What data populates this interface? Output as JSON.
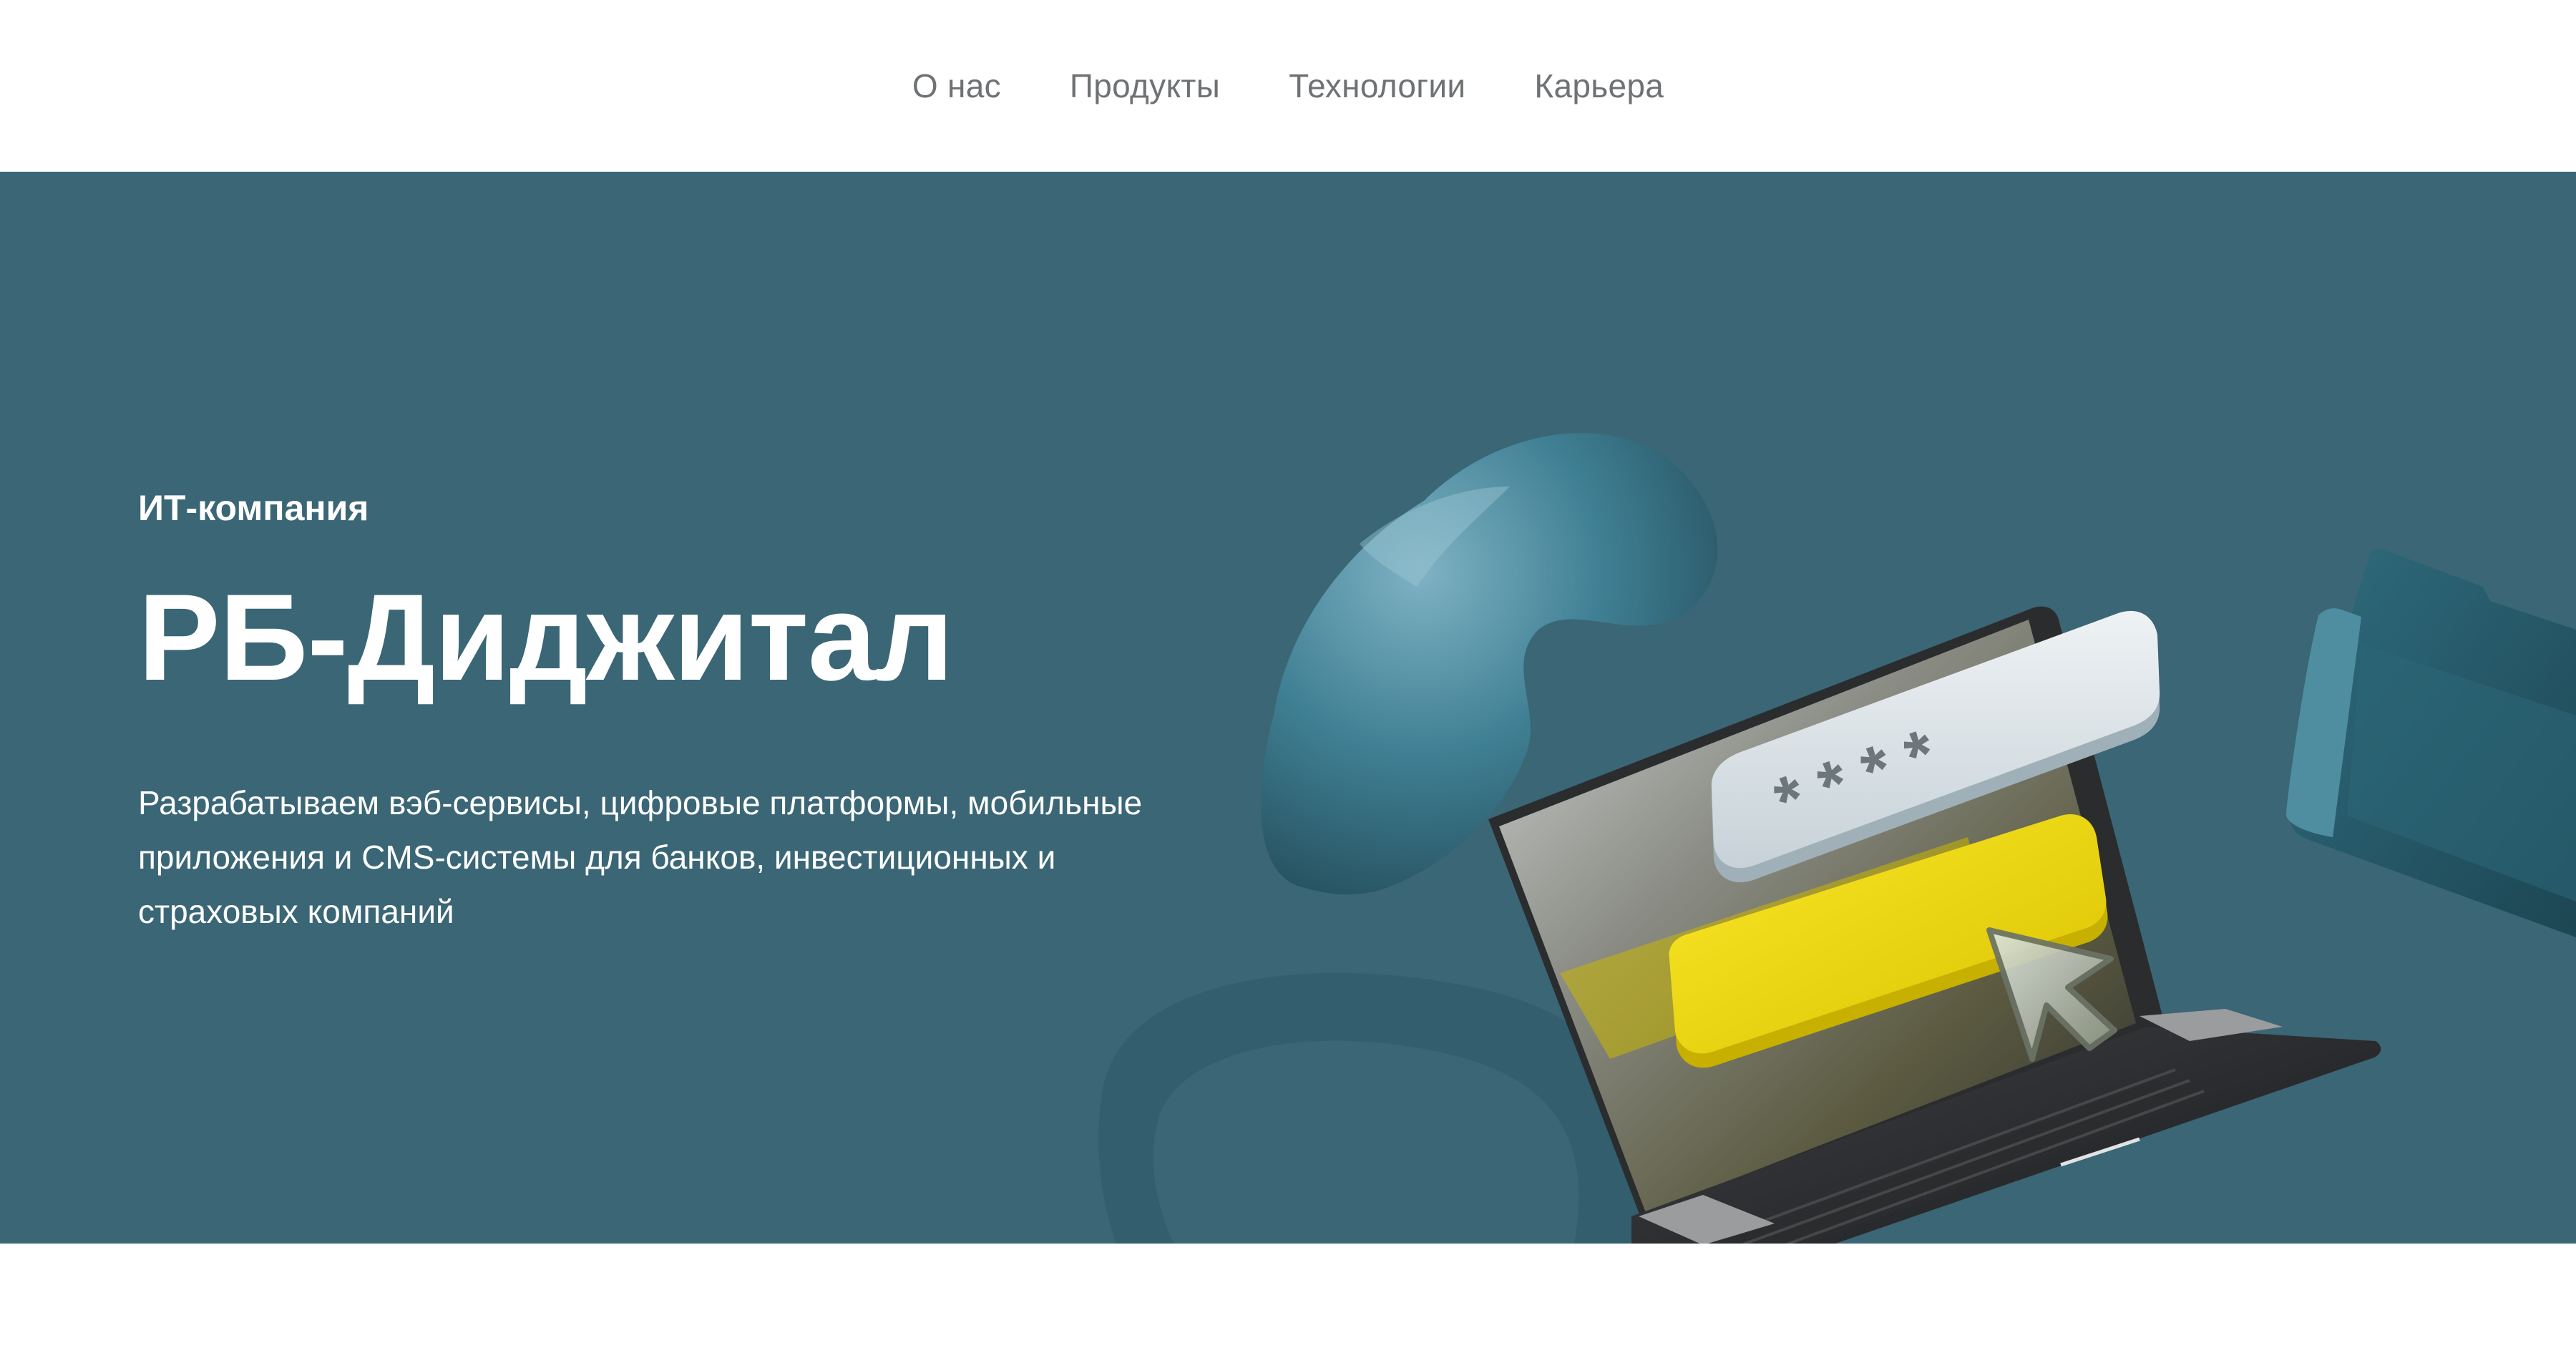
{
  "nav": {
    "items": [
      {
        "label": "О нас"
      },
      {
        "label": "Продукты"
      },
      {
        "label": "Технологии"
      },
      {
        "label": "Карьера"
      }
    ]
  },
  "hero": {
    "eyebrow": "ИТ-компания",
    "title": "РБ-Диджитал",
    "description": "Разрабатываем вэб-сервисы, цифровые платформы, мобильные приложения и CMS-системы для банков, инвестиционных и страховых компаний",
    "password_mask": "* * * *"
  },
  "colors": {
    "hero_background": "#3a6676",
    "nav_text": "#6f7275",
    "accent_yellow": "#f2dc00",
    "text_white": "#ffffff"
  }
}
